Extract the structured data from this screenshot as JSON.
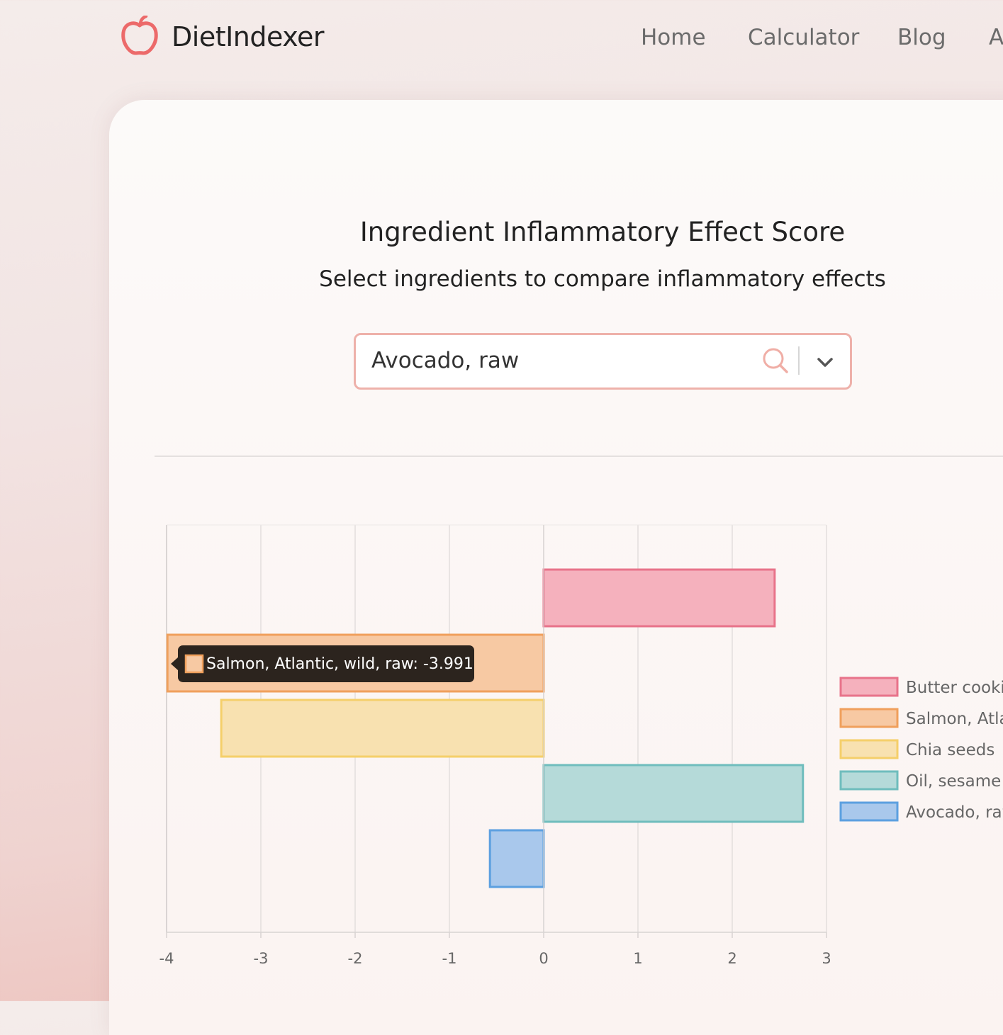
{
  "nav": {
    "brand": "DietIndexer",
    "links": [
      "Home",
      "Calculator",
      "Blog",
      "A"
    ]
  },
  "page": {
    "title": "Ingredient Inflammatory Effect Score",
    "subtitle": "Select ingredients to compare inflammatory effects"
  },
  "select": {
    "value": "Avocado, raw"
  },
  "tooltip": {
    "text": "Salmon, Atlantic, wild, raw: -3.991"
  },
  "legend_visible": [
    "Butter cookie",
    "Salmon, Atla",
    "Chia seeds",
    "Oil, sesame",
    "Avocado, raw"
  ],
  "chart_data": {
    "type": "bar",
    "orientation": "horizontal",
    "xlim": [
      -4,
      3
    ],
    "x_ticks": [
      "-4",
      "-3",
      "-2",
      "-1",
      "0",
      "1",
      "2",
      "3"
    ],
    "grid": true,
    "legend_position": "right",
    "series": [
      {
        "name": "Butter cookies",
        "value": 2.45,
        "fill": "#f5b1bd",
        "stroke": "#e8738a"
      },
      {
        "name": "Salmon, Atlantic, wild, raw",
        "value": -3.991,
        "fill": "#f7c9a3",
        "stroke": "#f0a05c"
      },
      {
        "name": "Chia seeds",
        "value": -3.42,
        "fill": "#f8e1b0",
        "stroke": "#f5cf6a"
      },
      {
        "name": "Oil, sesame",
        "value": 2.75,
        "fill": "#b5dad9",
        "stroke": "#6fbdbd"
      },
      {
        "name": "Avocado, raw",
        "value": -0.57,
        "fill": "#a9c8ec",
        "stroke": "#5ca0e0"
      }
    ]
  }
}
